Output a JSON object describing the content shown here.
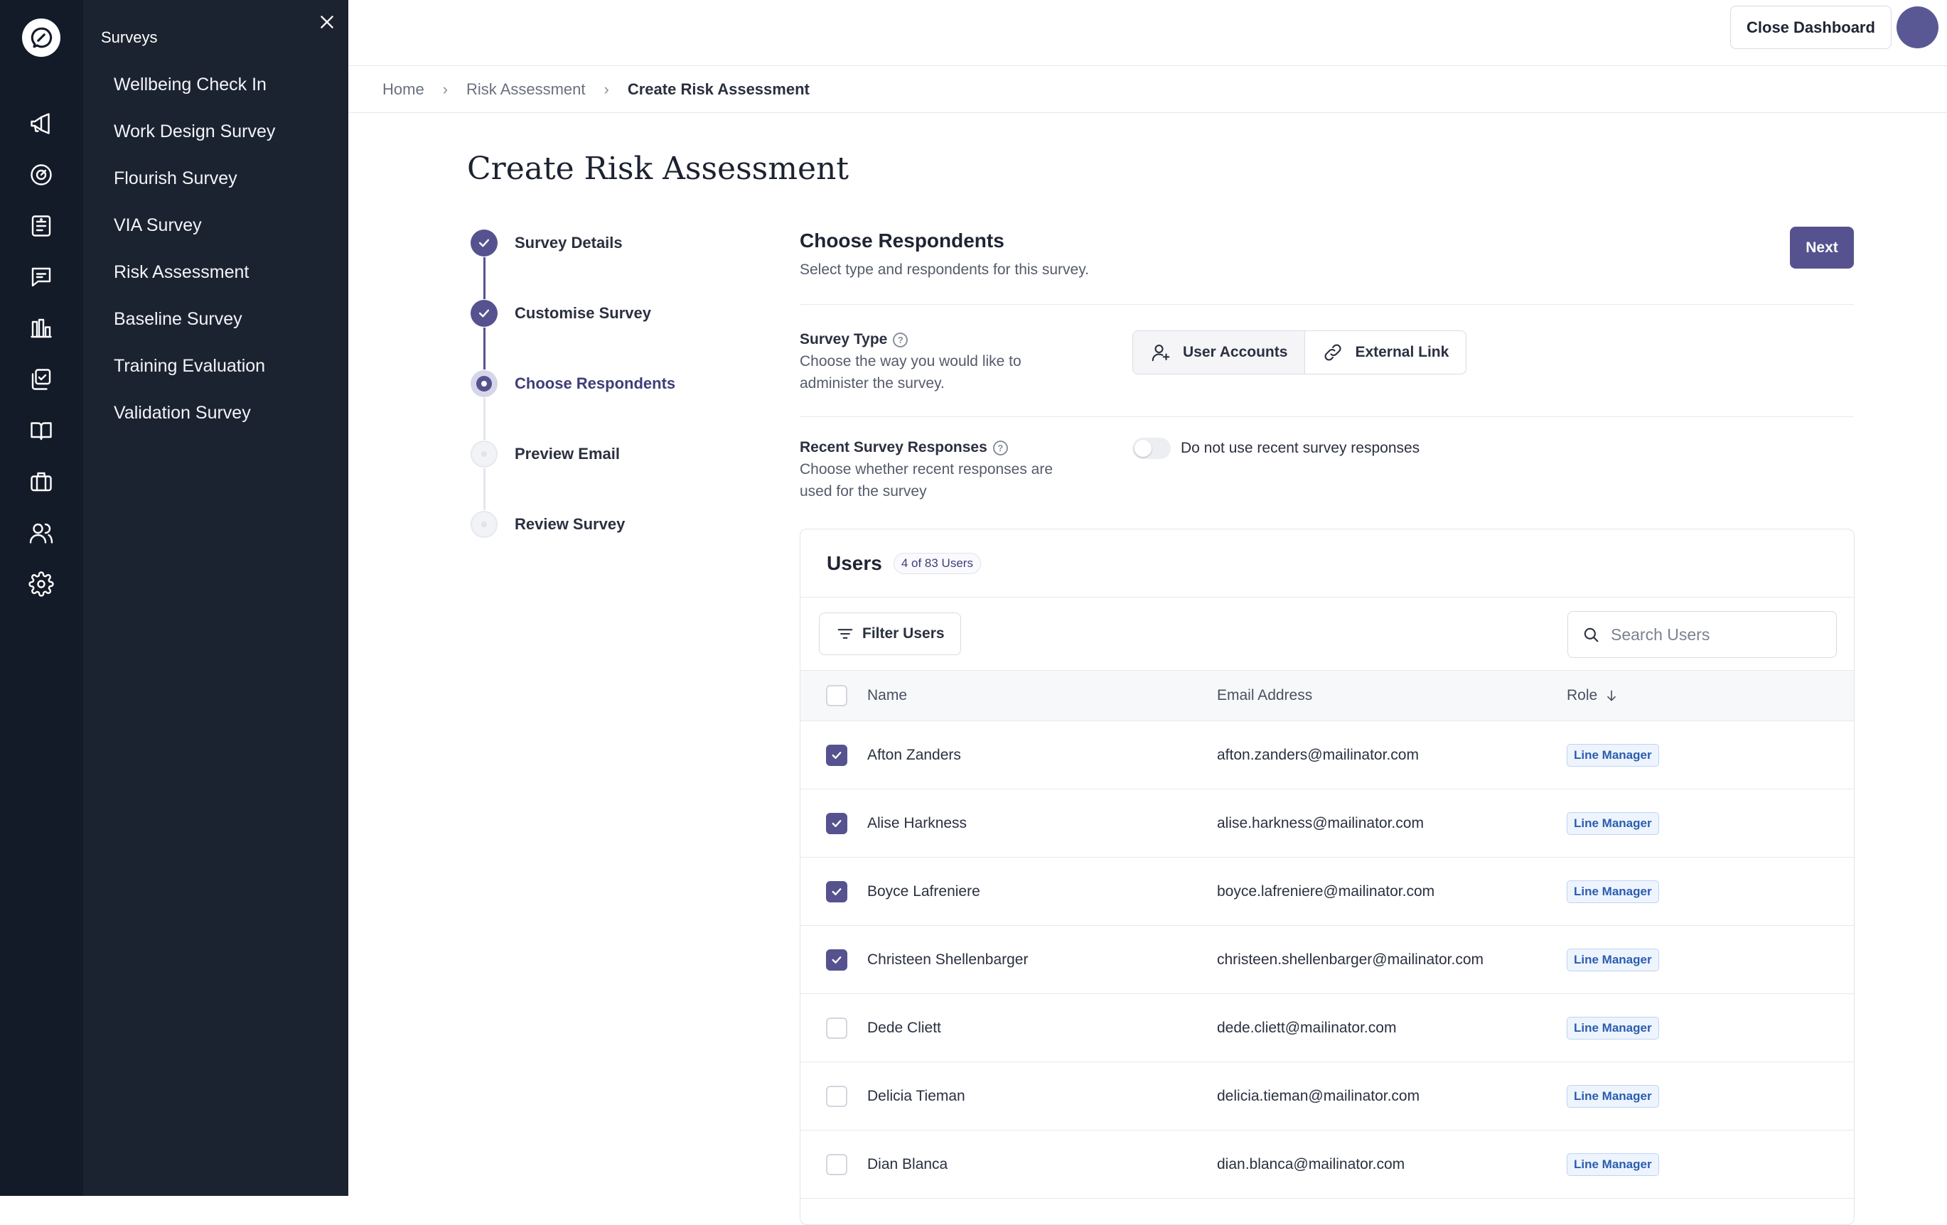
{
  "flyout": {
    "title": "Surveys",
    "items": [
      {
        "label": "Wellbeing Check In"
      },
      {
        "label": "Work Design Survey"
      },
      {
        "label": "Flourish Survey"
      },
      {
        "label": "VIA Survey"
      },
      {
        "label": "Risk Assessment"
      },
      {
        "label": "Baseline Survey"
      },
      {
        "label": "Training Evaluation"
      },
      {
        "label": "Validation Survey"
      }
    ]
  },
  "rail_icons": [
    "megaphone-icon",
    "gauge-icon",
    "survey-icon",
    "chat-icon",
    "bar-chart-icon",
    "checklist-icon",
    "book-icon",
    "briefcase-icon",
    "users-icon",
    "gear-icon"
  ],
  "header": {
    "close_dashboard": "Close Dashboard"
  },
  "breadcrumb": {
    "home": "Home",
    "parent": "Risk Assessment",
    "current": "Create Risk Assessment"
  },
  "page": {
    "title": "Create Risk Assessment"
  },
  "stepper": [
    {
      "label": "Survey Details",
      "state": "done"
    },
    {
      "label": "Customise Survey",
      "state": "done"
    },
    {
      "label": "Choose Respondents",
      "state": "current"
    },
    {
      "label": "Preview Email",
      "state": "todo"
    },
    {
      "label": "Review Survey",
      "state": "todo"
    }
  ],
  "section": {
    "title": "Choose Respondents",
    "subtitle": "Select type and respondents for this survey.",
    "next_label": "Next"
  },
  "survey_type": {
    "label": "Survey Type",
    "help": "?",
    "description": "Choose the way you would like to administer the survey.",
    "options": [
      {
        "label": "User Accounts",
        "selected": true
      },
      {
        "label": "External Link",
        "selected": false
      }
    ]
  },
  "recent_responses": {
    "label": "Recent Survey Responses",
    "help": "?",
    "description": "Choose whether recent responses are used for the survey",
    "toggle_label": "Do not use recent survey responses",
    "toggle_on": false
  },
  "users": {
    "title": "Users",
    "badge": "4 of 83 Users",
    "filter_label": "Filter Users",
    "search_placeholder": "Search Users",
    "columns": {
      "name": "Name",
      "email": "Email Address",
      "role": "Role"
    },
    "rows": [
      {
        "name": "Afton Zanders",
        "email": "afton.zanders@mailinator.com",
        "role": "Line Manager",
        "checked": true
      },
      {
        "name": "Alise Harkness",
        "email": "alise.harkness@mailinator.com",
        "role": "Line Manager",
        "checked": true
      },
      {
        "name": "Boyce Lafreniere",
        "email": "boyce.lafreniere@mailinator.com",
        "role": "Line Manager",
        "checked": true
      },
      {
        "name": "Christeen Shellenbarger",
        "email": "christeen.shellenbarger@mailinator.com",
        "role": "Line Manager",
        "checked": true
      },
      {
        "name": "Dede Cliett",
        "email": "dede.cliett@mailinator.com",
        "role": "Line Manager",
        "checked": false
      },
      {
        "name": "Delicia Tieman",
        "email": "delicia.tieman@mailinator.com",
        "role": "Line Manager",
        "checked": false
      },
      {
        "name": "Dian Blanca",
        "email": "dian.blanca@mailinator.com",
        "role": "Line Manager",
        "checked": false
      }
    ]
  },
  "colors": {
    "rail_bg": "#141b28",
    "flyout_bg": "#1c2330",
    "accent": "#55528f",
    "role_badge": "#2a5db0"
  }
}
